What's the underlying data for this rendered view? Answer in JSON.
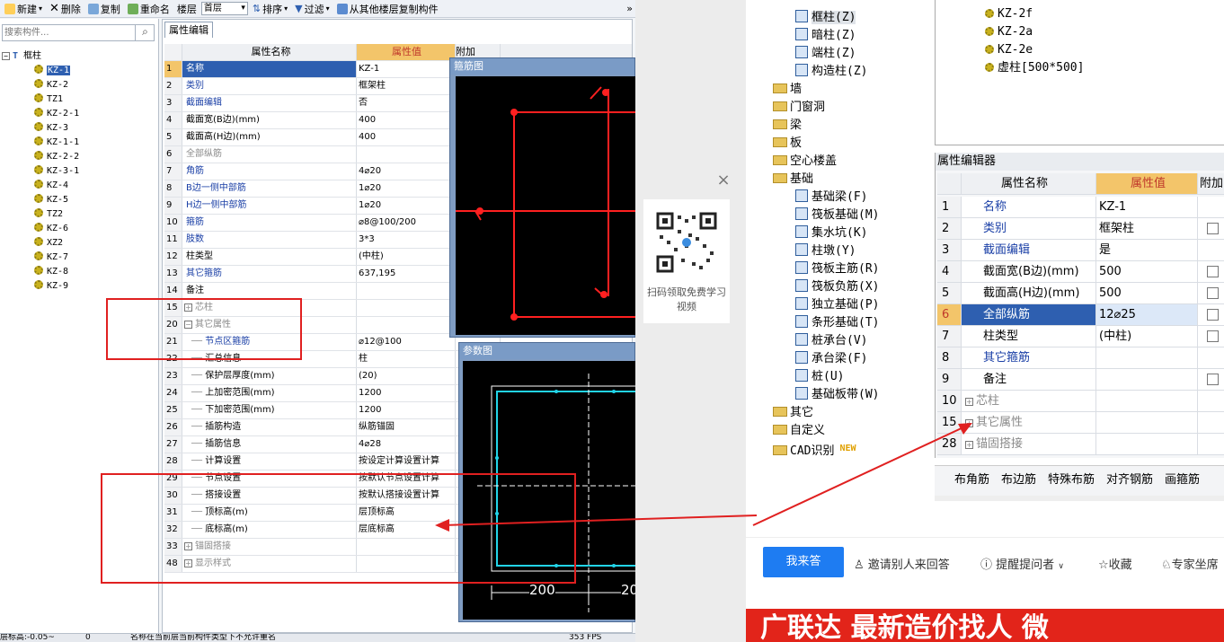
{
  "toolbar": {
    "items": [
      "新建",
      "删除",
      "复制",
      "重命名",
      "楼层",
      "排序",
      "过滤",
      "从其他楼层复制构件"
    ],
    "floor_value": "首层",
    "more": "»"
  },
  "left": {
    "search_placeholder": "搜索构件...",
    "tree_root": "框柱",
    "tree_items": [
      "KZ-1",
      "KZ-2",
      "TZ1",
      "KZ-2-1",
      "KZ-3",
      "KZ-1-1",
      "KZ-2-2",
      "KZ-3-1",
      "KZ-4",
      "KZ-5",
      "TZ2",
      "KZ-6",
      "XZ2",
      "KZ-7",
      "KZ-8",
      "KZ-9"
    ]
  },
  "editor": {
    "tab": "属性编辑",
    "headers": {
      "name": "属性名称",
      "value": "属性值",
      "extra": "附加"
    },
    "rows": [
      {
        "n": "1",
        "name": "名称",
        "value": "KZ-1",
        "style": "sel"
      },
      {
        "n": "2",
        "name": "类别",
        "value": "框架柱",
        "style": "blue"
      },
      {
        "n": "3",
        "name": "截面编辑",
        "value": "否",
        "style": "blue"
      },
      {
        "n": "4",
        "name": "截面宽(B边)(mm)",
        "value": "400",
        "style": ""
      },
      {
        "n": "5",
        "name": "截面高(H边)(mm)",
        "value": "400",
        "style": ""
      },
      {
        "n": "6",
        "name": "全部纵筋",
        "value": "",
        "style": "gray"
      },
      {
        "n": "7",
        "name": "角筋",
        "value": "4⌀20",
        "style": "blue"
      },
      {
        "n": "8",
        "name": "B边一侧中部筋",
        "value": "1⌀20",
        "style": "blue"
      },
      {
        "n": "9",
        "name": "H边一侧中部筋",
        "value": "1⌀20",
        "style": "blue"
      },
      {
        "n": "10",
        "name": "箍筋",
        "value": "⌀8@100/200",
        "style": "blue"
      },
      {
        "n": "11",
        "name": "肢数",
        "value": "3*3",
        "style": "blue"
      },
      {
        "n": "12",
        "name": "柱类型",
        "value": "(中柱)",
        "style": ""
      },
      {
        "n": "13",
        "name": "其它箍筋",
        "value": "637,195",
        "style": "blue"
      },
      {
        "n": "14",
        "name": "备注",
        "value": "",
        "style": ""
      },
      {
        "n": "15",
        "name": "芯柱",
        "value": "",
        "style": "gray",
        "prefix": "+"
      },
      {
        "n": "20",
        "name": "其它属性",
        "value": "",
        "style": "gray",
        "prefix": "−"
      },
      {
        "n": "21",
        "name": "节点区箍筋",
        "value": "⌀12@100",
        "style": "blue",
        "indent": true
      },
      {
        "n": "22",
        "name": "汇总信息",
        "value": "柱",
        "style": "",
        "indent": true
      },
      {
        "n": "23",
        "name": "保护层厚度(mm)",
        "value": "(20)",
        "style": "",
        "indent": true
      },
      {
        "n": "24",
        "name": "上加密范围(mm)",
        "value": "1200",
        "style": "",
        "indent": true
      },
      {
        "n": "25",
        "name": "下加密范围(mm)",
        "value": "1200",
        "style": "",
        "indent": true
      },
      {
        "n": "26",
        "name": "插筋构造",
        "value": "纵筋锚固",
        "style": "",
        "indent": true
      },
      {
        "n": "27",
        "name": "插筋信息",
        "value": "4⌀28",
        "style": "",
        "indent": true
      },
      {
        "n": "28",
        "name": "计算设置",
        "value": "按设定计算设置计算",
        "style": "",
        "indent": true
      },
      {
        "n": "29",
        "name": "节点设置",
        "value": "按默认节点设置计算",
        "style": "",
        "indent": true
      },
      {
        "n": "30",
        "name": "搭接设置",
        "value": "按默认搭接设置计算",
        "style": "",
        "indent": true
      },
      {
        "n": "31",
        "name": "顶标高(m)",
        "value": "层顶标高",
        "style": "",
        "indent": true
      },
      {
        "n": "32",
        "name": "底标高(m)",
        "value": "层底标高",
        "style": "",
        "indent": true
      },
      {
        "n": "33",
        "name": "锚固搭接",
        "value": "",
        "style": "gray",
        "prefix": "+"
      },
      {
        "n": "48",
        "name": "显示样式",
        "value": "",
        "style": "gray",
        "prefix": "+"
      }
    ]
  },
  "popups": {
    "stirrup_title": "箍筋图",
    "param_title": "参数图",
    "dim_a": "200",
    "dim_b": "20"
  },
  "status": {
    "floor": "层标高:-0.05~",
    "count": "0",
    "message": "名称在当前层当前构件类型下不允许重名",
    "fps": "353 FPS"
  },
  "qr": {
    "text": "扫码领取免费学习视频",
    "close": "×"
  },
  "right": {
    "top_items": [
      "KZ-2f",
      "KZ-2a",
      "KZ-2e",
      "虚柱[500*500]"
    ],
    "tree": [
      {
        "label": "框柱(Z)",
        "kind": "item",
        "sel": true
      },
      {
        "label": "暗柱(Z)",
        "kind": "item"
      },
      {
        "label": "端柱(Z)",
        "kind": "item"
      },
      {
        "label": "构造柱(Z)",
        "kind": "item"
      },
      {
        "label": "墙",
        "kind": "folder"
      },
      {
        "label": "门窗洞",
        "kind": "folder"
      },
      {
        "label": "梁",
        "kind": "folder"
      },
      {
        "label": "板",
        "kind": "folder"
      },
      {
        "label": "空心楼盖",
        "kind": "folder"
      },
      {
        "label": "基础",
        "kind": "folder"
      },
      {
        "label": "基础梁(F)",
        "kind": "item"
      },
      {
        "label": "筏板基础(M)",
        "kind": "item"
      },
      {
        "label": "集水坑(K)",
        "kind": "item"
      },
      {
        "label": "柱墩(Y)",
        "kind": "item"
      },
      {
        "label": "筏板主筋(R)",
        "kind": "item"
      },
      {
        "label": "筏板负筋(X)",
        "kind": "item"
      },
      {
        "label": "独立基础(P)",
        "kind": "item"
      },
      {
        "label": "条形基础(T)",
        "kind": "item"
      },
      {
        "label": "桩承台(V)",
        "kind": "item"
      },
      {
        "label": "承台梁(F)",
        "kind": "item"
      },
      {
        "label": "桩(U)",
        "kind": "item"
      },
      {
        "label": "基础板带(W)",
        "kind": "item"
      },
      {
        "label": "其它",
        "kind": "folder"
      },
      {
        "label": "自定义",
        "kind": "folder"
      },
      {
        "label": "CAD识别",
        "kind": "folder",
        "badge": "NEW"
      }
    ],
    "editor_title": "属性编辑器",
    "headers": {
      "name": "属性名称",
      "value": "属性值",
      "extra": "附加"
    },
    "rows": [
      {
        "n": "1",
        "name": "名称",
        "value": "KZ-1",
        "style": "blue",
        "cb": false
      },
      {
        "n": "2",
        "name": "类别",
        "value": "框架柱",
        "style": "blue",
        "cb": true
      },
      {
        "n": "3",
        "name": "截面编辑",
        "value": "是",
        "style": "blue",
        "cb": false
      },
      {
        "n": "4",
        "name": "截面宽(B边)(mm)",
        "value": "500",
        "style": "",
        "cb": true
      },
      {
        "n": "5",
        "name": "截面高(H边)(mm)",
        "value": "500",
        "style": "",
        "cb": true
      },
      {
        "n": "6",
        "name": "全部纵筋",
        "value": "12⌀25",
        "style": "sel",
        "cb": true
      },
      {
        "n": "7",
        "name": "柱类型",
        "value": "(中柱)",
        "style": "",
        "cb": true
      },
      {
        "n": "8",
        "name": "其它箍筋",
        "value": "",
        "style": "blue",
        "cb": false
      },
      {
        "n": "9",
        "name": "备注",
        "value": "",
        "style": "",
        "cb": true
      },
      {
        "n": "10",
        "name": "芯柱",
        "value": "",
        "style": "gray",
        "cb": false,
        "prefix": "+"
      },
      {
        "n": "15",
        "name": "其它属性",
        "value": "",
        "style": "gray",
        "cb": false,
        "prefix": "+"
      },
      {
        "n": "28",
        "name": "锚固搭接",
        "value": "",
        "style": "gray",
        "cb": false,
        "prefix": "+"
      }
    ],
    "tools": "布角筋　布边筋　特殊布筋　对齐钢筋　画箍筋",
    "answer_button": "我来答",
    "links": [
      "邀请别人来回答",
      "提醒提问者",
      "收藏",
      "专家坐席"
    ],
    "ad_text": "广联达 最新造价找人 微"
  },
  "colors": {
    "annotation_red": "#e02020",
    "selection": "#2e5fb0",
    "cad_red": "#ff2020",
    "cad_cyan": "#22d4e8"
  }
}
